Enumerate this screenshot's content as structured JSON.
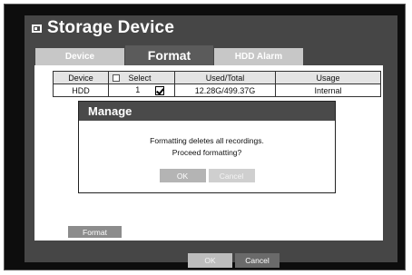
{
  "window": {
    "title": "Storage Device",
    "title_icon": "storage-device-icon"
  },
  "tabs": [
    {
      "label": "Device",
      "active": false
    },
    {
      "label": "Format",
      "active": true
    },
    {
      "label": "HDD Alarm",
      "active": false
    }
  ],
  "table": {
    "headers": {
      "device": "Device",
      "select": "Select",
      "used_total": "Used/Total",
      "usage": "Usage"
    },
    "select_all_checked": false,
    "rows": [
      {
        "device": "HDD",
        "index": "1",
        "checked": true,
        "used_total": "12.28G/499.37G",
        "usage": "Internal"
      }
    ]
  },
  "dialog": {
    "title": "Manage",
    "line1": "Formatting deletes all recordings.",
    "line2": "Proceed formatting?",
    "ok_label": "OK",
    "cancel_label": "Cancel"
  },
  "format_button": {
    "label": "Format"
  },
  "footer": {
    "ok_label": "OK",
    "cancel_label": "Cancel"
  },
  "colors": {
    "frame": "#0d0d0d",
    "window": "#464646",
    "active_tab": "#5b5b5b",
    "inactive_tab": "#c7c7c7",
    "dialog_title": "#4a4a4a"
  }
}
